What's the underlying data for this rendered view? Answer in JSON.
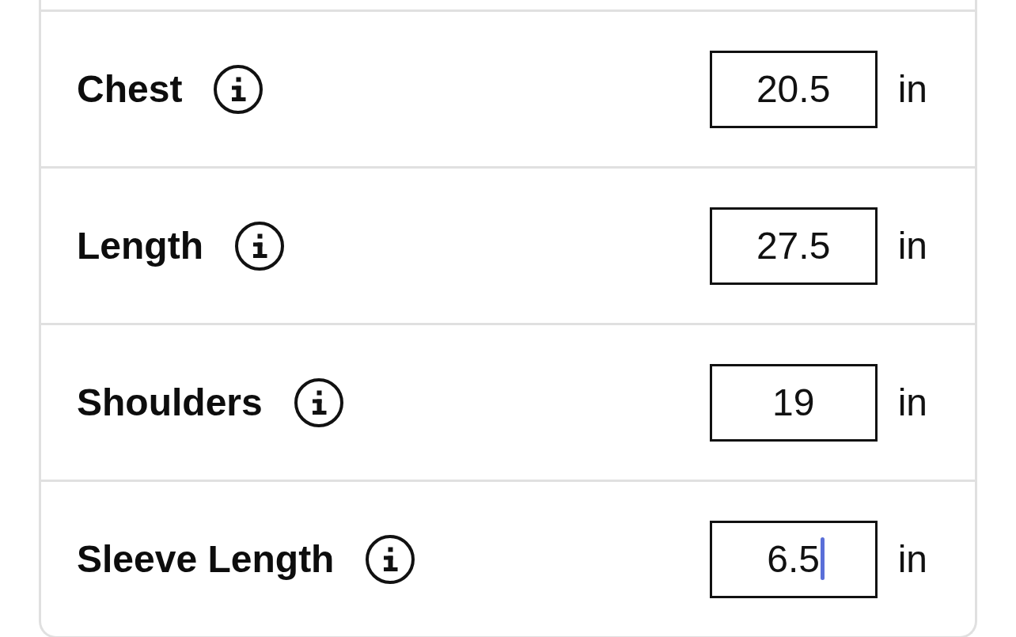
{
  "measurements": [
    {
      "label": "Chest",
      "value": "20.5",
      "unit": "in",
      "focused": false
    },
    {
      "label": "Length",
      "value": "27.5",
      "unit": "in",
      "focused": false
    },
    {
      "label": "Shoulders",
      "value": "19",
      "unit": "in",
      "focused": false
    },
    {
      "label": "Sleeve Length",
      "value": "6.5",
      "unit": "in",
      "focused": true
    }
  ]
}
